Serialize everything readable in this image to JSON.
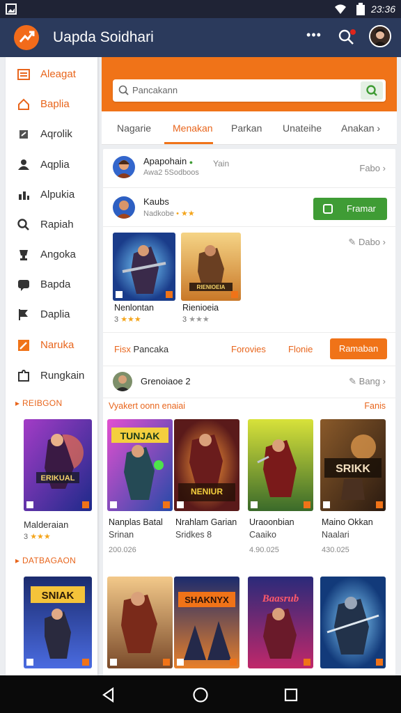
{
  "status": {
    "time": "23:36"
  },
  "app": {
    "title": "Uapda Soidhari"
  },
  "sidebar": {
    "items": [
      {
        "label": "Aleagat",
        "icon": "list-icon",
        "active": true
      },
      {
        "label": "Baplia",
        "icon": "home-icon",
        "active": true
      },
      {
        "label": "Aqrolik",
        "icon": "share-icon",
        "active": false
      },
      {
        "label": "Aqplia",
        "icon": "person-icon",
        "active": false
      },
      {
        "label": "Alpukia",
        "icon": "chart-icon",
        "active": false
      },
      {
        "label": "Rapiah",
        "icon": "search-icon",
        "active": false
      },
      {
        "label": "Angoka",
        "icon": "trophy-icon",
        "active": false
      },
      {
        "label": "Bapda",
        "icon": "chat-icon",
        "active": false
      },
      {
        "label": "Daplia",
        "icon": "flag-icon",
        "active": false
      },
      {
        "label": "Naruka",
        "icon": "edit-icon",
        "active": true
      },
      {
        "label": "Rungkain",
        "icon": "puzzle-icon",
        "active": false
      }
    ],
    "section1": "REIBGON",
    "section1_card": {
      "title": "Malderaian",
      "rating": "3"
    },
    "section2": "DATBAGAON"
  },
  "search": {
    "placeholder": "Pancakann"
  },
  "tabs": [
    "Nagarie",
    "Menakan",
    "Parkan",
    "Unateihe",
    "Anakan"
  ],
  "feed": {
    "row1": {
      "title": "Apapohain",
      "subtitle": "Awa2 5Sodboos",
      "tag": "Yain",
      "link": "Fabo"
    },
    "row2": {
      "title": "Kaubs",
      "subtitle": "Nadkobe",
      "button": "Framar"
    },
    "row3": {
      "link": "Dabo",
      "games": [
        {
          "title": "Nenlontan",
          "rating": "3"
        },
        {
          "title": "Rienioeia",
          "rating": "3"
        }
      ]
    },
    "row4": {
      "left1": "Fisx",
      "left2": "Pancaka",
      "mid1": "Forovies",
      "mid2": "Flonie",
      "button": "Ramaban"
    },
    "row5": {
      "title": "Grenoiaoe 2",
      "link": "Bang"
    },
    "section": {
      "title": "Vyakert oonn enaiai",
      "link": "Fanis"
    },
    "grid1": [
      {
        "title": "Nanplas Batal",
        "sub": "Srinan",
        "price": "200.026"
      },
      {
        "title": "Nrahlam Garian",
        "sub": "Sridkes 8",
        "price": ""
      },
      {
        "title": "Uraoonbian",
        "sub": "Caaiko",
        "price": "4.90.025"
      },
      {
        "title": "Maino Okkan",
        "sub": "Naalari",
        "price": "430.025"
      }
    ]
  },
  "colors": {
    "accent": "#f07318",
    "appbar": "#2b3a5c",
    "green": "#3f9c35"
  }
}
